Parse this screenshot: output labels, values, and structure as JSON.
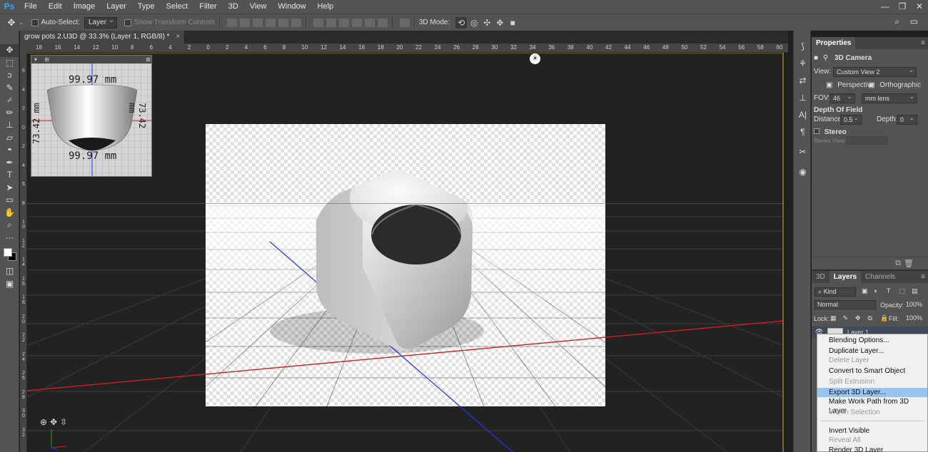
{
  "app": {
    "logo": "Ps",
    "menu": [
      "File",
      "Edit",
      "Image",
      "Layer",
      "Type",
      "Select",
      "Filter",
      "3D",
      "View",
      "Window",
      "Help"
    ],
    "window_controls": [
      "—",
      "❐",
      "✕"
    ]
  },
  "options_bar": {
    "auto_select_label": "Auto-Select:",
    "auto_select_value": "Layer",
    "show_transform_label": "Show Transform Controls",
    "mode3d_label": "3D Mode:"
  },
  "document": {
    "tab_title": "grow pots 2.U3D @ 33.3% (Layer 1, RGB/8) *",
    "tab_close": "×"
  },
  "ruler": {
    "top_ticks": [
      "18",
      "16",
      "14",
      "12",
      "10",
      "8",
      "6",
      "4",
      "2",
      "0",
      "2",
      "4",
      "6",
      "8",
      "10",
      "12",
      "14",
      "16",
      "18",
      "20",
      "22",
      "24",
      "26",
      "28",
      "30",
      "32",
      "34",
      "36",
      "38",
      "40",
      "42",
      "44",
      "46",
      "48",
      "50",
      "52",
      "54",
      "56",
      "58",
      "60"
    ],
    "left_ticks": [
      "6",
      "4",
      "2",
      "0",
      "2",
      "4",
      "6",
      "8",
      "1 0",
      "1 2",
      "1 4",
      "1 6",
      "1 8",
      "2 0",
      "2 2",
      "2 4",
      "2 6",
      "2 8",
      "3 0",
      "3 2"
    ]
  },
  "mini_view": {
    "dim_top": "99.97 mm",
    "dim_bottom": "99.97 mm",
    "dim_left": "73.42 mm",
    "dim_right": "73.42 mm"
  },
  "properties": {
    "tab": "Properties",
    "title": "3D Camera",
    "view_label": "View:",
    "view_value": "Custom View 2",
    "perspective_label": "Perspective",
    "orthographic_label": "Orthographic",
    "fov_label": "FOV:",
    "fov_value": "46",
    "lens_value": "mm lens",
    "dof_label": "Depth Of Field",
    "distance_label": "Distance:",
    "distance_value": "0.5",
    "depth_label": "Depth:",
    "depth_value": "0",
    "stereo_label": "Stereo",
    "stereo_view_label": "Stereo View:"
  },
  "layers": {
    "tabs": [
      "3D",
      "Layers",
      "Channels"
    ],
    "kind_label": "Kind",
    "blend_mode": "Normal",
    "opacity_label": "Opacity:",
    "opacity_value": "100%",
    "lock_label": "Lock:",
    "fill_label": "Fill:",
    "fill_value": "100%",
    "layer_name": "Layer 1"
  },
  "context_menu": {
    "items": [
      {
        "label": "Blending Options...",
        "state": "enabled"
      },
      {
        "label": "Duplicate Layer...",
        "state": "enabled"
      },
      {
        "label": "Delete Layer",
        "state": "disabled"
      },
      {
        "label": "Convert to Smart Object",
        "state": "enabled"
      },
      {
        "label": "Split Extrusion",
        "state": "disabled"
      },
      {
        "label": "Export 3D Layer...",
        "state": "selected"
      },
      {
        "label": "Make Work Path from 3D Layer",
        "state": "enabled"
      },
      {
        "label": "Within Selection",
        "state": "disabled"
      },
      {
        "label": "Invert Visible",
        "state": "enabled"
      },
      {
        "label": "Reveal All",
        "state": "disabled"
      },
      {
        "label": "Render 3D Layer",
        "state": "enabled"
      }
    ]
  },
  "colors": {
    "accent_selected": "#99c4f0",
    "axis_red": "#cc1f1f",
    "axis_blue": "#2030ff",
    "ps_blue": "#31a8ff"
  }
}
